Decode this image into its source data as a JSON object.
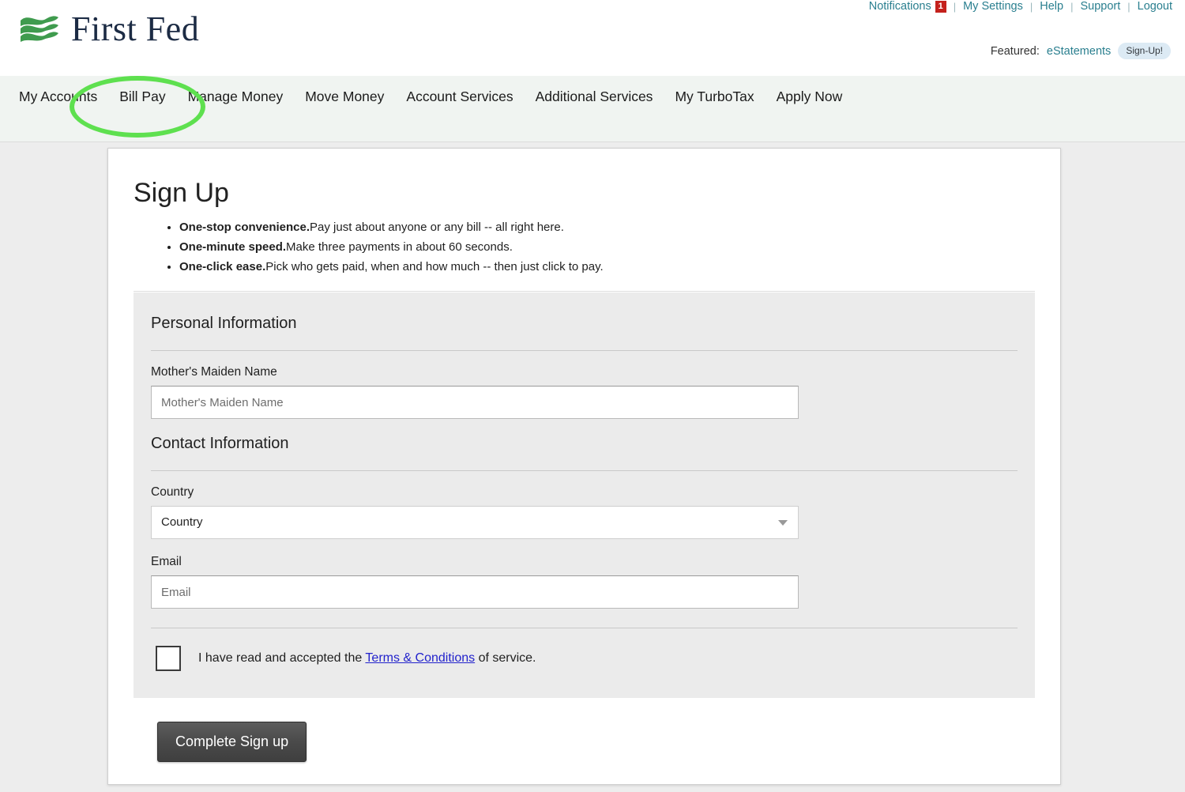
{
  "header": {
    "logo_text": "First Fed",
    "logo_mark_name": "wave-logo-icon",
    "util_nav": [
      {
        "label": "Notifications",
        "badge": "1"
      },
      {
        "label": "My Settings"
      },
      {
        "label": "Help"
      },
      {
        "label": "Support"
      },
      {
        "label": "Logout"
      }
    ],
    "separator": "|",
    "featured": {
      "label": "Featured:",
      "link": "eStatements",
      "pill": "Sign-Up!"
    },
    "colors": {
      "util_link": "#2a7f8f",
      "badge": "#c4211c",
      "pill_bg": "#dceaf4",
      "logo_navy": "#1c2b44",
      "logo_green": "#3f9b4e"
    }
  },
  "mainnav": {
    "items": [
      "My Accounts",
      "Bill Pay",
      "Manage Money",
      "Move Money",
      "Account Services",
      "Additional Services",
      "My TurboTax",
      "Apply Now"
    ]
  },
  "annotation": {
    "shape": "ellipse",
    "target": "Bill Pay",
    "color": "#5ee04f"
  },
  "main": {
    "title": "Sign Up",
    "benefits": [
      {
        "lead": "One-stop convenience.",
        "text": "Pay just about anyone or any bill -- all right here."
      },
      {
        "lead": "One-minute speed.",
        "text": "Make three payments in about 60 seconds."
      },
      {
        "lead": "One-click ease.",
        "text": "Pick who gets paid, when and how much -- then just click to pay."
      }
    ],
    "sections": {
      "personal": {
        "heading": "Personal Information",
        "maiden_name": {
          "label": "Mother's Maiden Name",
          "placeholder": "Mother's Maiden Name",
          "value": ""
        }
      },
      "contact": {
        "heading": "Contact Information",
        "country": {
          "label": "Country",
          "selected": "Country",
          "caret_icon": "chevron-down-icon"
        },
        "email": {
          "label": "Email",
          "placeholder": "Email",
          "value": ""
        }
      }
    },
    "terms": {
      "checked": false,
      "text_before": "I have read and accepted the ",
      "link": "Terms & Conditions",
      "text_after": " of service."
    },
    "submit_label": "Complete Sign up"
  }
}
